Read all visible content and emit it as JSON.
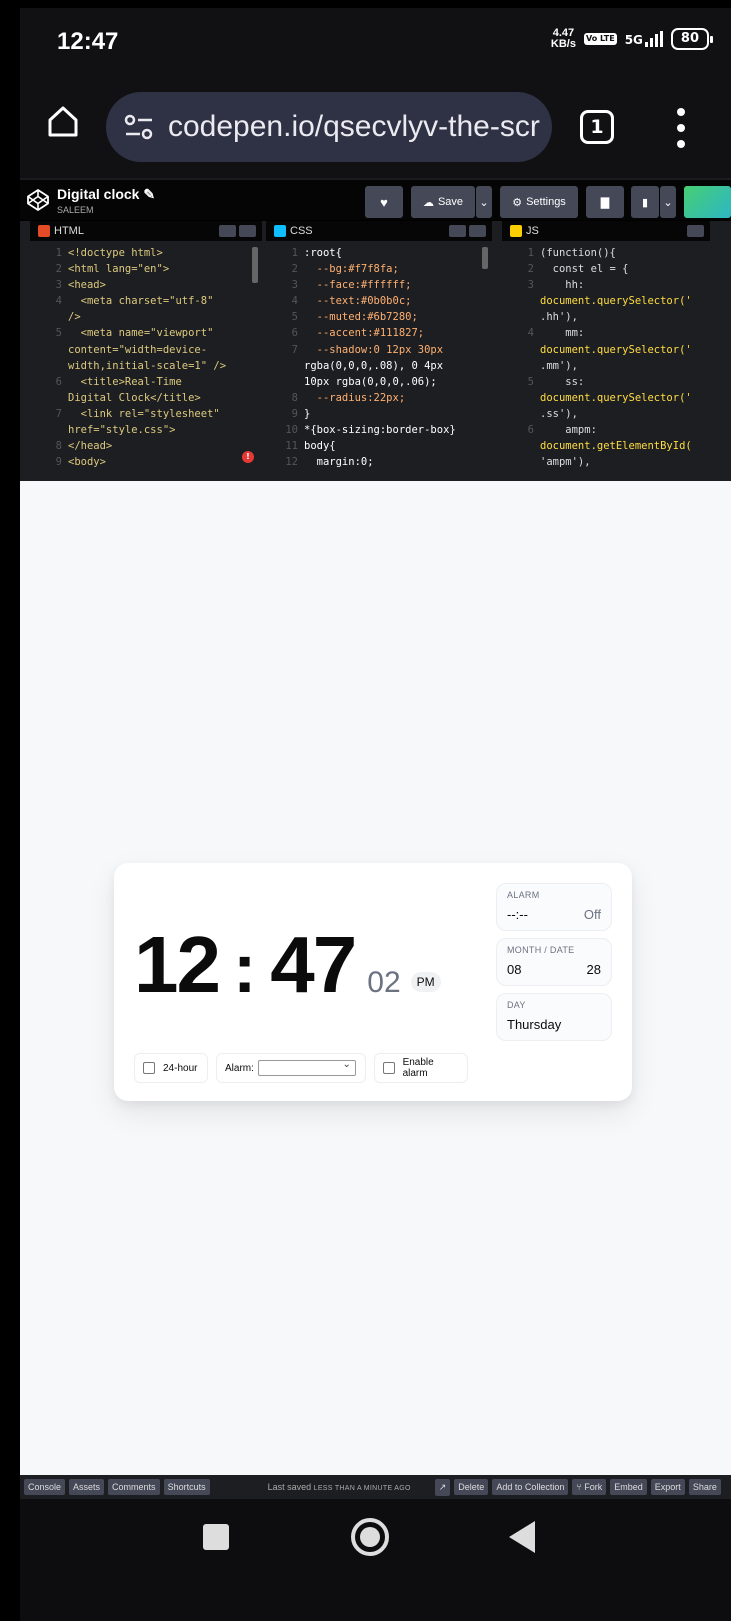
{
  "status_bar": {
    "time": "12:47",
    "net_speed_value": "4.47",
    "net_speed_unit": "KB/s",
    "volte": "Vo LTE",
    "network": "5G",
    "battery": "80"
  },
  "browser": {
    "url": "codepen.io/qsecvlyv-the-scr",
    "tab_count": "1"
  },
  "codepen": {
    "pen_title": "Digital clock",
    "author": "SALEEM",
    "save_label": "Save",
    "settings_label": "Settings"
  },
  "editors": {
    "html": {
      "label": "HTML",
      "lines": [
        {
          "n": "1",
          "t": "<!doctype html>"
        },
        {
          "n": "2",
          "t": "<html lang=\"en\">"
        },
        {
          "n": "3",
          "t": "<head>"
        },
        {
          "n": "4",
          "t": "  <meta charset=\"utf-8\""
        },
        {
          "n": "",
          "t": "/>"
        },
        {
          "n": "5",
          "t": "  <meta name=\"viewport\""
        },
        {
          "n": "",
          "t": "content=\"width=device-"
        },
        {
          "n": "",
          "t": "width,initial-scale=1\" />"
        },
        {
          "n": "6",
          "t": "  <title>Real-Time"
        },
        {
          "n": "",
          "t": "Digital Clock</title>"
        },
        {
          "n": "7",
          "t": "  <link rel=\"stylesheet\""
        },
        {
          "n": "",
          "t": "href=\"style.css\">"
        },
        {
          "n": "8",
          "t": "</head>"
        },
        {
          "n": "9",
          "t": "<body>"
        }
      ]
    },
    "css": {
      "label": "CSS",
      "lines": [
        {
          "n": "1",
          "t": ":root{"
        },
        {
          "n": "2",
          "t": "  --bg:#f7f8fa;"
        },
        {
          "n": "3",
          "t": "  --face:#ffffff;"
        },
        {
          "n": "4",
          "t": "  --text:#0b0b0c;"
        },
        {
          "n": "5",
          "t": "  --muted:#6b7280;"
        },
        {
          "n": "6",
          "t": "  --accent:#111827;"
        },
        {
          "n": "7",
          "t": "  --shadow:0 12px 30px"
        },
        {
          "n": "",
          "t": "rgba(0,0,0,.08), 0 4px"
        },
        {
          "n": "",
          "t": "10px rgba(0,0,0,.06);"
        },
        {
          "n": "8",
          "t": "  --radius:22px;"
        },
        {
          "n": "9",
          "t": "}"
        },
        {
          "n": "10",
          "t": "*{box-sizing:border-box}"
        },
        {
          "n": "11",
          "t": "body{"
        },
        {
          "n": "12",
          "t": "  margin:0;"
        }
      ]
    },
    "js": {
      "label": "JS",
      "lines": [
        {
          "n": "1",
          "t": "(function(){"
        },
        {
          "n": "2",
          "t": "  const el = {"
        },
        {
          "n": "3",
          "t": "    hh:"
        },
        {
          "n": "",
          "t": "document.querySelector('"
        },
        {
          "n": "",
          "t": ".hh'),"
        },
        {
          "n": "4",
          "t": "    mm:"
        },
        {
          "n": "",
          "t": "document.querySelector('"
        },
        {
          "n": "",
          "t": ".mm'),"
        },
        {
          "n": "5",
          "t": "    ss:"
        },
        {
          "n": "",
          "t": "document.querySelector('"
        },
        {
          "n": "",
          "t": ".ss'),"
        },
        {
          "n": "6",
          "t": "    ampm:"
        },
        {
          "n": "",
          "t": "document.getElementById("
        },
        {
          "n": "",
          "t": "'ampm'),"
        }
      ]
    }
  },
  "clock": {
    "hh": "12",
    "mm": "47",
    "ss": "02",
    "ampm": "PM",
    "alarm_label": "ALARM",
    "alarm_value": "--:--",
    "alarm_state": "Off",
    "month_date_label": "MONTH / DATE",
    "month": "08",
    "date": "28",
    "day_label": "DAY",
    "day": "Thursday",
    "toggle_24h_label": "24-hour",
    "alarm_select_label": "Alarm:",
    "enable_alarm_label": "Enable alarm"
  },
  "footer": {
    "console": "Console",
    "assets": "Assets",
    "comments": "Comments",
    "shortcuts": "Shortcuts",
    "last_saved": "Last saved",
    "last_saved_when": "LESS THAN A MINUTE AGO",
    "delete": "Delete",
    "add_to_collection": "Add to Collection",
    "fork": "Fork",
    "embed": "Embed",
    "export": "Export",
    "share": "Share"
  },
  "colors": {
    "preview_bg": "#f7f8fa",
    "face": "#ffffff",
    "text": "#0b0b0c",
    "muted": "#6b7280"
  }
}
